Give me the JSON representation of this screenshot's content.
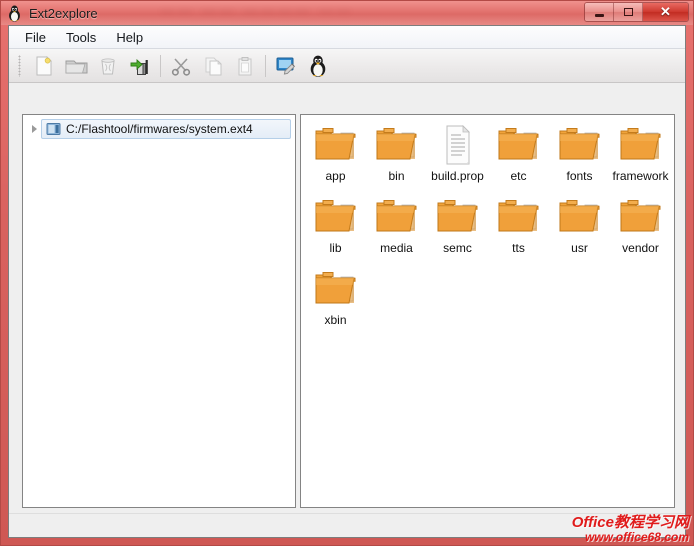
{
  "window": {
    "title": "Ext2explore",
    "app_icon": "tux-penguin-icon",
    "frame_color": "#d9625f",
    "title_blur_text": "——  ——   ————      ——",
    "controls": {
      "minimize": "–",
      "maximize": "□",
      "close": "✕"
    }
  },
  "menubar": {
    "items": [
      {
        "label": "File",
        "name": "menu-file"
      },
      {
        "label": "Tools",
        "name": "menu-tools"
      },
      {
        "label": "Help",
        "name": "menu-help"
      }
    ]
  },
  "toolbar": {
    "buttons": [
      {
        "name": "new-image-icon",
        "title": "New",
        "enabled": false
      },
      {
        "name": "open-folder-icon",
        "title": "Open Image",
        "enabled": true
      },
      {
        "name": "trash-icon",
        "title": "Delete",
        "enabled": false
      },
      {
        "name": "save-export-icon",
        "title": "Save / Export",
        "enabled": true
      },
      {
        "name": "separator",
        "title": "",
        "enabled": false
      },
      {
        "name": "cut-scissors-icon",
        "title": "Cut",
        "enabled": true
      },
      {
        "name": "copy-icon",
        "title": "Copy",
        "enabled": false
      },
      {
        "name": "paste-icon",
        "title": "Paste",
        "enabled": false
      },
      {
        "name": "separator",
        "title": "",
        "enabled": false
      },
      {
        "name": "properties-screen-icon",
        "title": "Properties",
        "enabled": true
      },
      {
        "name": "tux-penguin-icon",
        "title": "About",
        "enabled": true
      }
    ]
  },
  "tree": {
    "root": {
      "label": "C:/Flashtool/firmwares/system.ext4",
      "icon": "disk-image-icon",
      "expander": "chevron-right-icon",
      "selected": true
    }
  },
  "file_list": {
    "items": [
      {
        "name": "app",
        "type": "folder"
      },
      {
        "name": "bin",
        "type": "folder"
      },
      {
        "name": "build.prop",
        "type": "file"
      },
      {
        "name": "etc",
        "type": "folder"
      },
      {
        "name": "fonts",
        "type": "folder"
      },
      {
        "name": "framework",
        "type": "folder"
      },
      {
        "name": "lib",
        "type": "folder"
      },
      {
        "name": "media",
        "type": "folder"
      },
      {
        "name": "semc",
        "type": "folder"
      },
      {
        "name": "tts",
        "type": "folder"
      },
      {
        "name": "usr",
        "type": "folder"
      },
      {
        "name": "vendor",
        "type": "folder"
      },
      {
        "name": "xbin",
        "type": "folder"
      }
    ]
  },
  "statusbar": {
    "text": ""
  },
  "watermark": {
    "line1": "Office教程学习网",
    "line2": "www.office68.com",
    "color": "#e01b1b"
  }
}
